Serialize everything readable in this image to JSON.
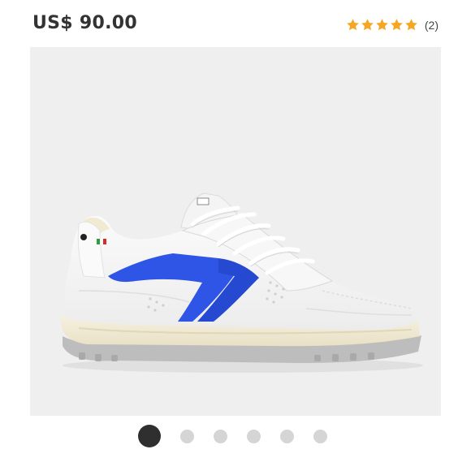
{
  "product": {
    "price": "US$ 90.00",
    "rating": 5,
    "review_count": "(2)",
    "star_color": "#f5a623",
    "gallery": {
      "image_count": 6,
      "active_index": 0,
      "accent_color": "#2e55e6"
    }
  }
}
